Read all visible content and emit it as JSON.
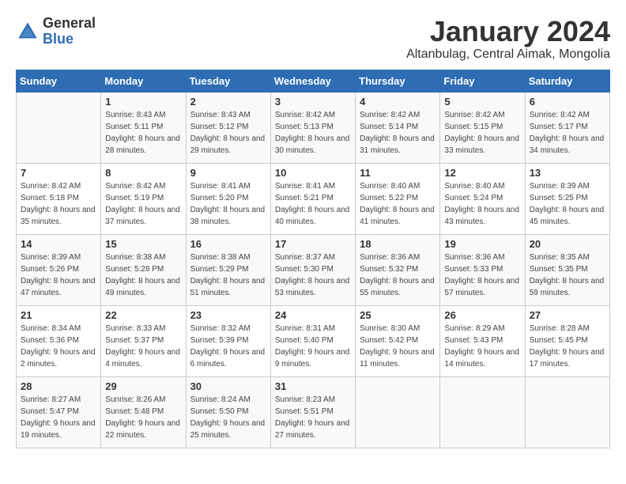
{
  "logo": {
    "general": "General",
    "blue": "Blue"
  },
  "header": {
    "month_year": "January 2024",
    "location": "Altanbulag, Central Aimak, Mongolia"
  },
  "days_of_week": [
    "Sunday",
    "Monday",
    "Tuesday",
    "Wednesday",
    "Thursday",
    "Friday",
    "Saturday"
  ],
  "weeks": [
    {
      "days": [
        {
          "number": "",
          "sunrise": "",
          "sunset": "",
          "daylight": ""
        },
        {
          "number": "1",
          "sunrise": "Sunrise: 8:43 AM",
          "sunset": "Sunset: 5:11 PM",
          "daylight": "Daylight: 8 hours and 28 minutes."
        },
        {
          "number": "2",
          "sunrise": "Sunrise: 8:43 AM",
          "sunset": "Sunset: 5:12 PM",
          "daylight": "Daylight: 8 hours and 29 minutes."
        },
        {
          "number": "3",
          "sunrise": "Sunrise: 8:42 AM",
          "sunset": "Sunset: 5:13 PM",
          "daylight": "Daylight: 8 hours and 30 minutes."
        },
        {
          "number": "4",
          "sunrise": "Sunrise: 8:42 AM",
          "sunset": "Sunset: 5:14 PM",
          "daylight": "Daylight: 8 hours and 31 minutes."
        },
        {
          "number": "5",
          "sunrise": "Sunrise: 8:42 AM",
          "sunset": "Sunset: 5:15 PM",
          "daylight": "Daylight: 8 hours and 33 minutes."
        },
        {
          "number": "6",
          "sunrise": "Sunrise: 8:42 AM",
          "sunset": "Sunset: 5:17 PM",
          "daylight": "Daylight: 8 hours and 34 minutes."
        }
      ]
    },
    {
      "days": [
        {
          "number": "7",
          "sunrise": "Sunrise: 8:42 AM",
          "sunset": "Sunset: 5:18 PM",
          "daylight": "Daylight: 8 hours and 35 minutes."
        },
        {
          "number": "8",
          "sunrise": "Sunrise: 8:42 AM",
          "sunset": "Sunset: 5:19 PM",
          "daylight": "Daylight: 8 hours and 37 minutes."
        },
        {
          "number": "9",
          "sunrise": "Sunrise: 8:41 AM",
          "sunset": "Sunset: 5:20 PM",
          "daylight": "Daylight: 8 hours and 38 minutes."
        },
        {
          "number": "10",
          "sunrise": "Sunrise: 8:41 AM",
          "sunset": "Sunset: 5:21 PM",
          "daylight": "Daylight: 8 hours and 40 minutes."
        },
        {
          "number": "11",
          "sunrise": "Sunrise: 8:40 AM",
          "sunset": "Sunset: 5:22 PM",
          "daylight": "Daylight: 8 hours and 41 minutes."
        },
        {
          "number": "12",
          "sunrise": "Sunrise: 8:40 AM",
          "sunset": "Sunset: 5:24 PM",
          "daylight": "Daylight: 8 hours and 43 minutes."
        },
        {
          "number": "13",
          "sunrise": "Sunrise: 8:39 AM",
          "sunset": "Sunset: 5:25 PM",
          "daylight": "Daylight: 8 hours and 45 minutes."
        }
      ]
    },
    {
      "days": [
        {
          "number": "14",
          "sunrise": "Sunrise: 8:39 AM",
          "sunset": "Sunset: 5:26 PM",
          "daylight": "Daylight: 8 hours and 47 minutes."
        },
        {
          "number": "15",
          "sunrise": "Sunrise: 8:38 AM",
          "sunset": "Sunset: 5:28 PM",
          "daylight": "Daylight: 8 hours and 49 minutes."
        },
        {
          "number": "16",
          "sunrise": "Sunrise: 8:38 AM",
          "sunset": "Sunset: 5:29 PM",
          "daylight": "Daylight: 8 hours and 51 minutes."
        },
        {
          "number": "17",
          "sunrise": "Sunrise: 8:37 AM",
          "sunset": "Sunset: 5:30 PM",
          "daylight": "Daylight: 8 hours and 53 minutes."
        },
        {
          "number": "18",
          "sunrise": "Sunrise: 8:36 AM",
          "sunset": "Sunset: 5:32 PM",
          "daylight": "Daylight: 8 hours and 55 minutes."
        },
        {
          "number": "19",
          "sunrise": "Sunrise: 8:36 AM",
          "sunset": "Sunset: 5:33 PM",
          "daylight": "Daylight: 8 hours and 57 minutes."
        },
        {
          "number": "20",
          "sunrise": "Sunrise: 8:35 AM",
          "sunset": "Sunset: 5:35 PM",
          "daylight": "Daylight: 8 hours and 59 minutes."
        }
      ]
    },
    {
      "days": [
        {
          "number": "21",
          "sunrise": "Sunrise: 8:34 AM",
          "sunset": "Sunset: 5:36 PM",
          "daylight": "Daylight: 9 hours and 2 minutes."
        },
        {
          "number": "22",
          "sunrise": "Sunrise: 8:33 AM",
          "sunset": "Sunset: 5:37 PM",
          "daylight": "Daylight: 9 hours and 4 minutes."
        },
        {
          "number": "23",
          "sunrise": "Sunrise: 8:32 AM",
          "sunset": "Sunset: 5:39 PM",
          "daylight": "Daylight: 9 hours and 6 minutes."
        },
        {
          "number": "24",
          "sunrise": "Sunrise: 8:31 AM",
          "sunset": "Sunset: 5:40 PM",
          "daylight": "Daylight: 9 hours and 9 minutes."
        },
        {
          "number": "25",
          "sunrise": "Sunrise: 8:30 AM",
          "sunset": "Sunset: 5:42 PM",
          "daylight": "Daylight: 9 hours and 11 minutes."
        },
        {
          "number": "26",
          "sunrise": "Sunrise: 8:29 AM",
          "sunset": "Sunset: 5:43 PM",
          "daylight": "Daylight: 9 hours and 14 minutes."
        },
        {
          "number": "27",
          "sunrise": "Sunrise: 8:28 AM",
          "sunset": "Sunset: 5:45 PM",
          "daylight": "Daylight: 9 hours and 17 minutes."
        }
      ]
    },
    {
      "days": [
        {
          "number": "28",
          "sunrise": "Sunrise: 8:27 AM",
          "sunset": "Sunset: 5:47 PM",
          "daylight": "Daylight: 9 hours and 19 minutes."
        },
        {
          "number": "29",
          "sunrise": "Sunrise: 8:26 AM",
          "sunset": "Sunset: 5:48 PM",
          "daylight": "Daylight: 9 hours and 22 minutes."
        },
        {
          "number": "30",
          "sunrise": "Sunrise: 8:24 AM",
          "sunset": "Sunset: 5:50 PM",
          "daylight": "Daylight: 9 hours and 25 minutes."
        },
        {
          "number": "31",
          "sunrise": "Sunrise: 8:23 AM",
          "sunset": "Sunset: 5:51 PM",
          "daylight": "Daylight: 9 hours and 27 minutes."
        },
        {
          "number": "",
          "sunrise": "",
          "sunset": "",
          "daylight": ""
        },
        {
          "number": "",
          "sunrise": "",
          "sunset": "",
          "daylight": ""
        },
        {
          "number": "",
          "sunrise": "",
          "sunset": "",
          "daylight": ""
        }
      ]
    }
  ]
}
